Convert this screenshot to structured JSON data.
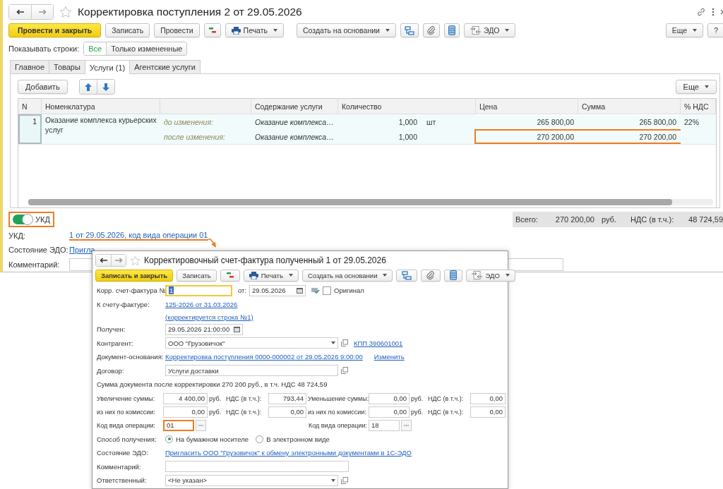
{
  "document": {
    "title": "Корректировка поступления 2 от 29.05.2026",
    "toolbar": {
      "post_close": "Провести и закрыть",
      "save": "Записать",
      "post": "Провести",
      "print": "Печать",
      "create_based": "Создать на основании",
      "edo": "ЭДО",
      "more": "Еще",
      "help": "?"
    },
    "show_rows": {
      "label": "Показывать строки:",
      "options": [
        {
          "label": "Все",
          "selected": true
        },
        {
          "label": "Только измененные",
          "selected": false
        }
      ]
    },
    "tabs": [
      {
        "label": "Главное",
        "selected": false
      },
      {
        "label": "Товары",
        "selected": false
      },
      {
        "label": "Услуги (1)",
        "selected": true
      },
      {
        "label": "Агентские услуги",
        "selected": false
      }
    ],
    "table_toolbar": {
      "add": "Добавить",
      "more": "Еще"
    },
    "table": {
      "columns": [
        "N",
        "Номенклатура",
        "Содержание услуги",
        "Количество",
        "Цена",
        "Сумма",
        "% НДС"
      ],
      "rows": [
        {
          "n": "1",
          "name": "Оказание комплекса курьерских услуг",
          "selected": true,
          "before": {
            "label": "до изменения:",
            "content": "Оказание комплекса…",
            "quantity": "1,000",
            "unit": "шт",
            "price": "265 800,00",
            "sum": "265 800,00",
            "vat": "22%",
            "highlighted": false
          },
          "after": {
            "label": "после изменения:",
            "content": "Оказание комплекса…",
            "quantity": "1,000",
            "price": "270 200,00",
            "sum": "270 200,00",
            "highlighted": true
          }
        }
      ]
    },
    "ukd_toggle": {
      "label": "УКД",
      "on": true,
      "highlighted": true
    },
    "totals": {
      "total_label": "Всего:",
      "total": "270 200,00",
      "currency": "руб.",
      "vat_label": "НДС (в т.ч.):",
      "vat": "48 724,59"
    },
    "ukd": {
      "label": "УКД:",
      "link": "1 от 29.05.2026, код вида операции 01",
      "highlighted": true
    },
    "edo": {
      "label": "Состояние ЭДО:",
      "link": "Пригла"
    },
    "comment": {
      "label": "Комментарий:"
    }
  },
  "invoice": {
    "title": "Корректировочный счет-фактура полученный 1 от 29.05.2026",
    "toolbar": {
      "save_close": "Записать и закрыть",
      "save": "Записать",
      "print": "Печать",
      "create_based": "Создать на основании",
      "edo": "ЭДО"
    },
    "number": {
      "label": "Корр. счет-фактура №:",
      "value": "1",
      "focused": true,
      "date_label": "от:",
      "date": "29.05.2026"
    },
    "original": {
      "label": "Оригинал",
      "checked": false
    },
    "base_invoice": {
      "label": "К счету-фактуре:",
      "link": "125-2026 от 31.03.2026",
      "note": "(корректируется строка №1)"
    },
    "received": {
      "label": "Получен:",
      "value": "29.05.2026 21:00:00"
    },
    "counterparty": {
      "label": "Контрагент:",
      "value": "ООО \"Грузовичок\"",
      "kpp": "КПП 390601001"
    },
    "basis": {
      "label": "Документ-основания:",
      "link": "Корректировка поступления 0000-000002 от 29.05.2026 9:00:00",
      "change": "Изменить"
    },
    "contract": {
      "label": "Договор:",
      "value": "Услуги доставки"
    },
    "summary": "Сумма документа после корректировки 270 200 руб., в т.ч. НДС 48 724,59",
    "amounts": [
      {
        "left": {
          "label": "Увеличение суммы:",
          "value": "4 400,00",
          "currency": "руб.",
          "vat_label": "НДС (в т.ч.):",
          "vat": "793,44"
        },
        "right": {
          "label": "Уменьшение суммы:",
          "value": "0,00",
          "currency": "руб.",
          "vat_label": "НДС (в т.ч.):",
          "vat": "0,00"
        }
      },
      {
        "left": {
          "label": "из них по комиссии:",
          "value": "0,00",
          "currency": "руб.",
          "vat_label": "НДС (в т.ч.):",
          "vat": "0,00"
        },
        "right": {
          "label": "из них по комиссии:",
          "value": "0,00",
          "currency": "руб.",
          "vat_label": "НДС (в т.ч.):",
          "vat": "0,00"
        }
      }
    ],
    "op_codes": {
      "left": {
        "label": "Код вида операции:",
        "value": "01",
        "highlighted": true
      },
      "right": {
        "label": "Код вида операции:",
        "value": "18",
        "highlighted": false
      }
    },
    "receipt": {
      "label": "Способ получения:",
      "options": [
        {
          "label": "На бумажном носителе",
          "selected": true
        },
        {
          "label": "В электронном виде",
          "selected": false
        }
      ]
    },
    "edo": {
      "label": "Состояние ЭДО:",
      "link": "Пригласить ООО \"Грузовичок\" к обмену электронными документами в 1С-ЭДО"
    },
    "comment": {
      "label": "Комментарий:"
    },
    "responsible": {
      "label": "Ответственный:",
      "value": "<Не указан>"
    }
  }
}
